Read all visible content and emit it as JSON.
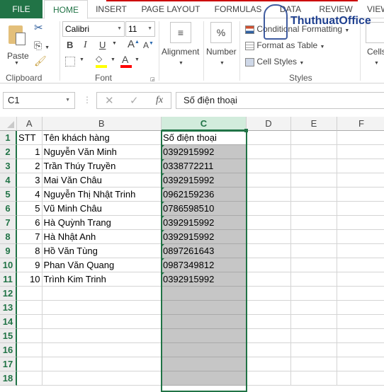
{
  "ribbon_tabs": [
    "FILE",
    "HOME",
    "INSERT",
    "PAGE LAYOUT",
    "FORMULAS",
    "DATA",
    "REVIEW",
    "VIEW"
  ],
  "clipboard": {
    "paste": "Paste",
    "label": "Clipboard"
  },
  "font": {
    "name": "Calibri",
    "size": "11",
    "label": "Font",
    "bold": "B",
    "italic": "I",
    "underline": "U",
    "fill_color": "#ffff00",
    "font_color": "#ff0000"
  },
  "alignment": {
    "label": "Alignment"
  },
  "number": {
    "label": "Number",
    "icon": "%"
  },
  "styles": {
    "conditional": "Conditional Formatting",
    "format_table": "Format as Table",
    "cell_styles": "Cell Styles",
    "label": "Styles"
  },
  "cells": {
    "label": "Cells"
  },
  "watermark": "ThuthuatOffice",
  "formula_bar": {
    "name_box": "C1",
    "fx": "fx",
    "value": "Số điện thoại"
  },
  "columns": [
    "A",
    "B",
    "C",
    "D",
    "E",
    "F"
  ],
  "selected_column": "C",
  "accent": "#217346",
  "rows": [
    {
      "n": "1",
      "a": "STT",
      "b": "Tên khách hàng",
      "c": "Số điện thoại"
    },
    {
      "n": "2",
      "a": "1",
      "b": "Nguyễn Văn Minh",
      "c": "0392915992"
    },
    {
      "n": "3",
      "a": "2",
      "b": "Trần Thúy Truyền",
      "c": "0338772211"
    },
    {
      "n": "4",
      "a": "3",
      "b": "Mai Văn Châu",
      "c": "0392915992"
    },
    {
      "n": "5",
      "a": "4",
      "b": "Nguyễn Thị Nhật Trinh",
      "c": "0962159236"
    },
    {
      "n": "6",
      "a": "5",
      "b": "Vũ Minh Châu",
      "c": "0786598510"
    },
    {
      "n": "7",
      "a": "6",
      "b": "Hà Quỳnh Trang",
      "c": "0392915992"
    },
    {
      "n": "8",
      "a": "7",
      "b": "Hà Nhật Anh",
      "c": "0392915992"
    },
    {
      "n": "9",
      "a": "8",
      "b": "Hồ Văn Tùng",
      "c": "0897261643"
    },
    {
      "n": "10",
      "a": "9",
      "b": "Phan Văn Quang",
      "c": "0987349812"
    },
    {
      "n": "11",
      "a": "10",
      "b": "Trình Kim Trinh",
      "c": "0392915992"
    },
    {
      "n": "12",
      "a": "",
      "b": "",
      "c": ""
    },
    {
      "n": "13",
      "a": "",
      "b": "",
      "c": ""
    },
    {
      "n": "14",
      "a": "",
      "b": "",
      "c": ""
    },
    {
      "n": "15",
      "a": "",
      "b": "",
      "c": ""
    },
    {
      "n": "16",
      "a": "",
      "b": "",
      "c": ""
    },
    {
      "n": "17",
      "a": "",
      "b": "",
      "c": ""
    },
    {
      "n": "18",
      "a": "",
      "b": "",
      "c": ""
    }
  ]
}
